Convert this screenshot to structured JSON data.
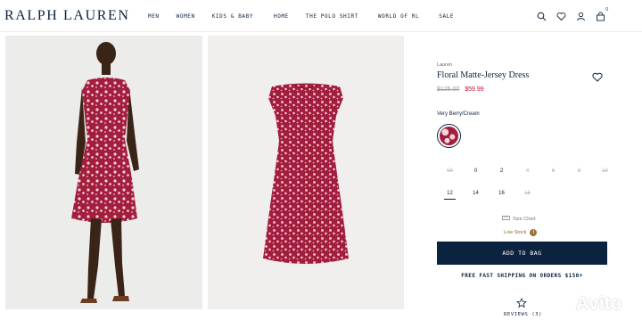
{
  "header": {
    "logo": "RALPH LAUREN",
    "nav": [
      "MEN",
      "WOMEN",
      "KIDS & BABY",
      "HOME",
      "THE POLO SHIRT",
      "WORLD OF RL",
      "SALE"
    ],
    "bag_count": "0"
  },
  "product": {
    "brand": "Lauren",
    "title": "Floral Matte-Jersey Dress",
    "price_original": "$125.00",
    "price_sale": "$59.99",
    "color_name": "Very Berry/Cream",
    "sizes_row1": [
      {
        "label": "00",
        "available": false
      },
      {
        "label": "0",
        "available": true
      },
      {
        "label": "2",
        "available": true
      },
      {
        "label": "4",
        "available": false
      },
      {
        "label": "6",
        "available": false
      },
      {
        "label": "8",
        "available": false
      },
      {
        "label": "10",
        "available": false
      }
    ],
    "sizes_row2": [
      {
        "label": "12",
        "available": true,
        "selected": true
      },
      {
        "label": "14",
        "available": true
      },
      {
        "label": "16",
        "available": true
      },
      {
        "label": "16",
        "available": false
      }
    ],
    "size_chart_label": "Size Chart",
    "stock_label": "Low Stock",
    "info_icon_text": "!",
    "add_to_bag_label": "ADD TO BAG",
    "shipping_text": "FREE FAST SHIPPING ON ORDERS $150+",
    "reviews_label": "REVIEWS",
    "reviews_count": "(3)"
  },
  "watermark": {
    "text": "Avito"
  },
  "colors": {
    "navy": "#0c2340",
    "sale_red": "#c8102e",
    "dress_red": "#a31d3d",
    "low_stock_gold": "#9a7432"
  },
  "icons": [
    "search-icon",
    "heart-icon",
    "user-icon",
    "bag-icon",
    "wishlist-heart-icon",
    "ruler-icon",
    "star-icon"
  ]
}
